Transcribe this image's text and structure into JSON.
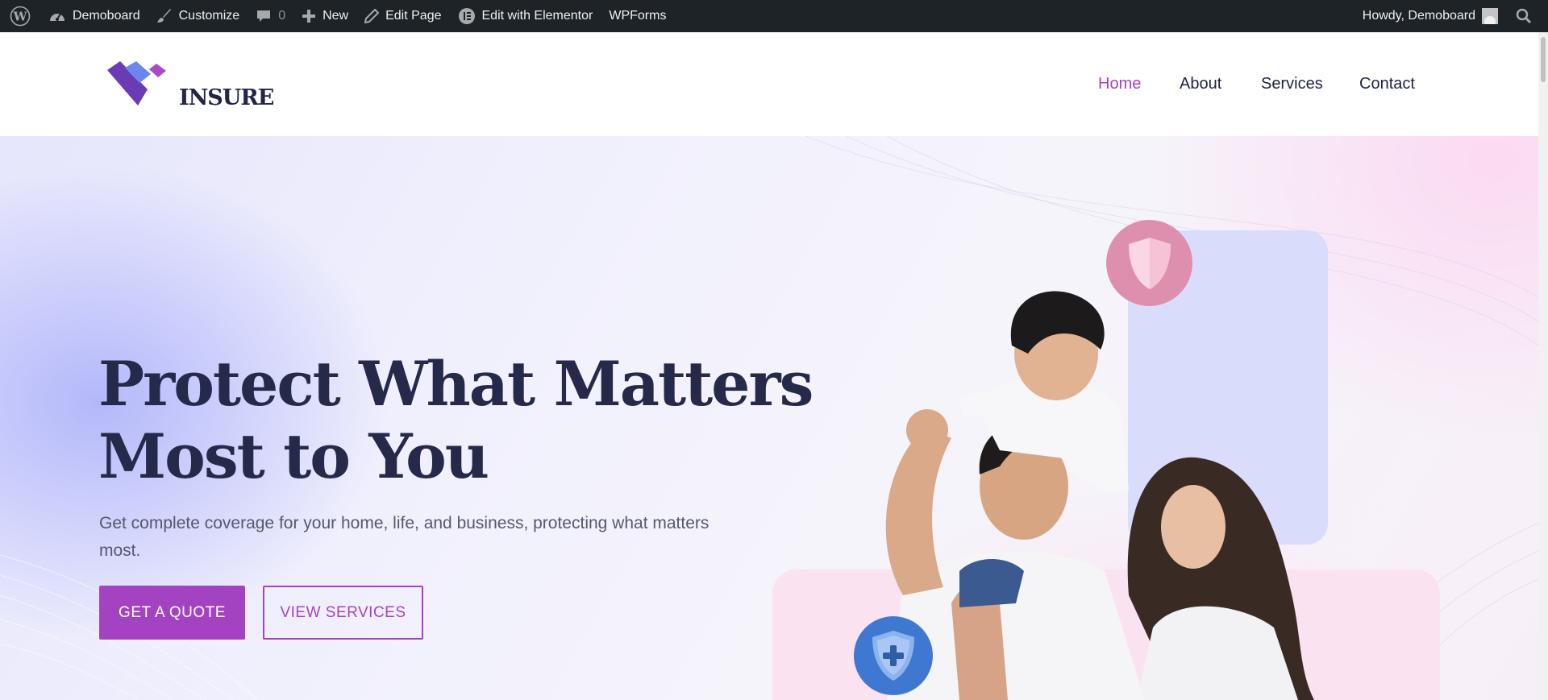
{
  "admin_bar": {
    "site_name": "Demoboard",
    "customize": "Customize",
    "comments_count": "0",
    "new": "New",
    "edit_page": "Edit Page",
    "edit_elementor": "Edit with Elementor",
    "wpforms": "WPForms",
    "howdy": "Howdy, Demoboard"
  },
  "header": {
    "logo_text": "INSURE",
    "nav": [
      {
        "label": "Home",
        "active": true
      },
      {
        "label": "About",
        "active": false
      },
      {
        "label": "Services",
        "active": false
      },
      {
        "label": "Contact",
        "active": false
      }
    ]
  },
  "hero": {
    "headline_line1": "Protect What Matters",
    "headline_line2": "Most to You",
    "subtext": "Get complete coverage for your home, life, and business, protecting what matters most.",
    "primary_button": "GET A QUOTE",
    "secondary_button": "VIEW SERVICES"
  },
  "colors": {
    "accent": "#a443c2",
    "nav_active": "#a443c2",
    "admin_bar_bg": "#1d2327",
    "heading": "#252a4a",
    "badge_pink": "#de8fad",
    "badge_blue": "#3f78d0"
  },
  "icons": {
    "wp_logo": "wordpress-icon",
    "dashboard": "dashboard-icon",
    "customize": "brush-icon",
    "comments": "comment-icon",
    "new": "plus-icon",
    "edit": "pencil-icon",
    "elementor": "elementor-icon",
    "search": "search-icon",
    "shield_pink": "shield-icon",
    "shield_blue": "medical-shield-icon"
  }
}
